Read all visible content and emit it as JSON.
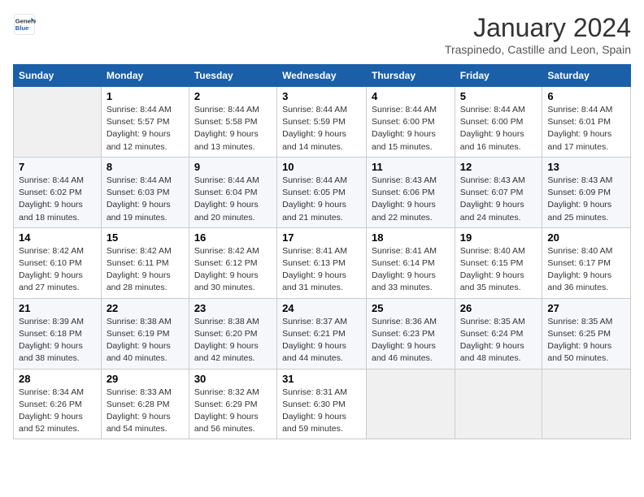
{
  "logo": {
    "line1": "General",
    "line2": "Blue"
  },
  "title": "January 2024",
  "subtitle": "Traspinedo, Castille and Leon, Spain",
  "days_of_week": [
    "Sunday",
    "Monday",
    "Tuesday",
    "Wednesday",
    "Thursday",
    "Friday",
    "Saturday"
  ],
  "weeks": [
    [
      {
        "day": "",
        "sunrise": "",
        "sunset": "",
        "daylight": ""
      },
      {
        "day": "1",
        "sunrise": "Sunrise: 8:44 AM",
        "sunset": "Sunset: 5:57 PM",
        "daylight": "Daylight: 9 hours and 12 minutes."
      },
      {
        "day": "2",
        "sunrise": "Sunrise: 8:44 AM",
        "sunset": "Sunset: 5:58 PM",
        "daylight": "Daylight: 9 hours and 13 minutes."
      },
      {
        "day": "3",
        "sunrise": "Sunrise: 8:44 AM",
        "sunset": "Sunset: 5:59 PM",
        "daylight": "Daylight: 9 hours and 14 minutes."
      },
      {
        "day": "4",
        "sunrise": "Sunrise: 8:44 AM",
        "sunset": "Sunset: 6:00 PM",
        "daylight": "Daylight: 9 hours and 15 minutes."
      },
      {
        "day": "5",
        "sunrise": "Sunrise: 8:44 AM",
        "sunset": "Sunset: 6:00 PM",
        "daylight": "Daylight: 9 hours and 16 minutes."
      },
      {
        "day": "6",
        "sunrise": "Sunrise: 8:44 AM",
        "sunset": "Sunset: 6:01 PM",
        "daylight": "Daylight: 9 hours and 17 minutes."
      }
    ],
    [
      {
        "day": "7",
        "sunrise": "Sunrise: 8:44 AM",
        "sunset": "Sunset: 6:02 PM",
        "daylight": "Daylight: 9 hours and 18 minutes."
      },
      {
        "day": "8",
        "sunrise": "Sunrise: 8:44 AM",
        "sunset": "Sunset: 6:03 PM",
        "daylight": "Daylight: 9 hours and 19 minutes."
      },
      {
        "day": "9",
        "sunrise": "Sunrise: 8:44 AM",
        "sunset": "Sunset: 6:04 PM",
        "daylight": "Daylight: 9 hours and 20 minutes."
      },
      {
        "day": "10",
        "sunrise": "Sunrise: 8:44 AM",
        "sunset": "Sunset: 6:05 PM",
        "daylight": "Daylight: 9 hours and 21 minutes."
      },
      {
        "day": "11",
        "sunrise": "Sunrise: 8:43 AM",
        "sunset": "Sunset: 6:06 PM",
        "daylight": "Daylight: 9 hours and 22 minutes."
      },
      {
        "day": "12",
        "sunrise": "Sunrise: 8:43 AM",
        "sunset": "Sunset: 6:07 PM",
        "daylight": "Daylight: 9 hours and 24 minutes."
      },
      {
        "day": "13",
        "sunrise": "Sunrise: 8:43 AM",
        "sunset": "Sunset: 6:09 PM",
        "daylight": "Daylight: 9 hours and 25 minutes."
      }
    ],
    [
      {
        "day": "14",
        "sunrise": "Sunrise: 8:42 AM",
        "sunset": "Sunset: 6:10 PM",
        "daylight": "Daylight: 9 hours and 27 minutes."
      },
      {
        "day": "15",
        "sunrise": "Sunrise: 8:42 AM",
        "sunset": "Sunset: 6:11 PM",
        "daylight": "Daylight: 9 hours and 28 minutes."
      },
      {
        "day": "16",
        "sunrise": "Sunrise: 8:42 AM",
        "sunset": "Sunset: 6:12 PM",
        "daylight": "Daylight: 9 hours and 30 minutes."
      },
      {
        "day": "17",
        "sunrise": "Sunrise: 8:41 AM",
        "sunset": "Sunset: 6:13 PM",
        "daylight": "Daylight: 9 hours and 31 minutes."
      },
      {
        "day": "18",
        "sunrise": "Sunrise: 8:41 AM",
        "sunset": "Sunset: 6:14 PM",
        "daylight": "Daylight: 9 hours and 33 minutes."
      },
      {
        "day": "19",
        "sunrise": "Sunrise: 8:40 AM",
        "sunset": "Sunset: 6:15 PM",
        "daylight": "Daylight: 9 hours and 35 minutes."
      },
      {
        "day": "20",
        "sunrise": "Sunrise: 8:40 AM",
        "sunset": "Sunset: 6:17 PM",
        "daylight": "Daylight: 9 hours and 36 minutes."
      }
    ],
    [
      {
        "day": "21",
        "sunrise": "Sunrise: 8:39 AM",
        "sunset": "Sunset: 6:18 PM",
        "daylight": "Daylight: 9 hours and 38 minutes."
      },
      {
        "day": "22",
        "sunrise": "Sunrise: 8:38 AM",
        "sunset": "Sunset: 6:19 PM",
        "daylight": "Daylight: 9 hours and 40 minutes."
      },
      {
        "day": "23",
        "sunrise": "Sunrise: 8:38 AM",
        "sunset": "Sunset: 6:20 PM",
        "daylight": "Daylight: 9 hours and 42 minutes."
      },
      {
        "day": "24",
        "sunrise": "Sunrise: 8:37 AM",
        "sunset": "Sunset: 6:21 PM",
        "daylight": "Daylight: 9 hours and 44 minutes."
      },
      {
        "day": "25",
        "sunrise": "Sunrise: 8:36 AM",
        "sunset": "Sunset: 6:23 PM",
        "daylight": "Daylight: 9 hours and 46 minutes."
      },
      {
        "day": "26",
        "sunrise": "Sunrise: 8:35 AM",
        "sunset": "Sunset: 6:24 PM",
        "daylight": "Daylight: 9 hours and 48 minutes."
      },
      {
        "day": "27",
        "sunrise": "Sunrise: 8:35 AM",
        "sunset": "Sunset: 6:25 PM",
        "daylight": "Daylight: 9 hours and 50 minutes."
      }
    ],
    [
      {
        "day": "28",
        "sunrise": "Sunrise: 8:34 AM",
        "sunset": "Sunset: 6:26 PM",
        "daylight": "Daylight: 9 hours and 52 minutes."
      },
      {
        "day": "29",
        "sunrise": "Sunrise: 8:33 AM",
        "sunset": "Sunset: 6:28 PM",
        "daylight": "Daylight: 9 hours and 54 minutes."
      },
      {
        "day": "30",
        "sunrise": "Sunrise: 8:32 AM",
        "sunset": "Sunset: 6:29 PM",
        "daylight": "Daylight: 9 hours and 56 minutes."
      },
      {
        "day": "31",
        "sunrise": "Sunrise: 8:31 AM",
        "sunset": "Sunset: 6:30 PM",
        "daylight": "Daylight: 9 hours and 59 minutes."
      },
      {
        "day": "",
        "sunrise": "",
        "sunset": "",
        "daylight": ""
      },
      {
        "day": "",
        "sunrise": "",
        "sunset": "",
        "daylight": ""
      },
      {
        "day": "",
        "sunrise": "",
        "sunset": "",
        "daylight": ""
      }
    ]
  ]
}
